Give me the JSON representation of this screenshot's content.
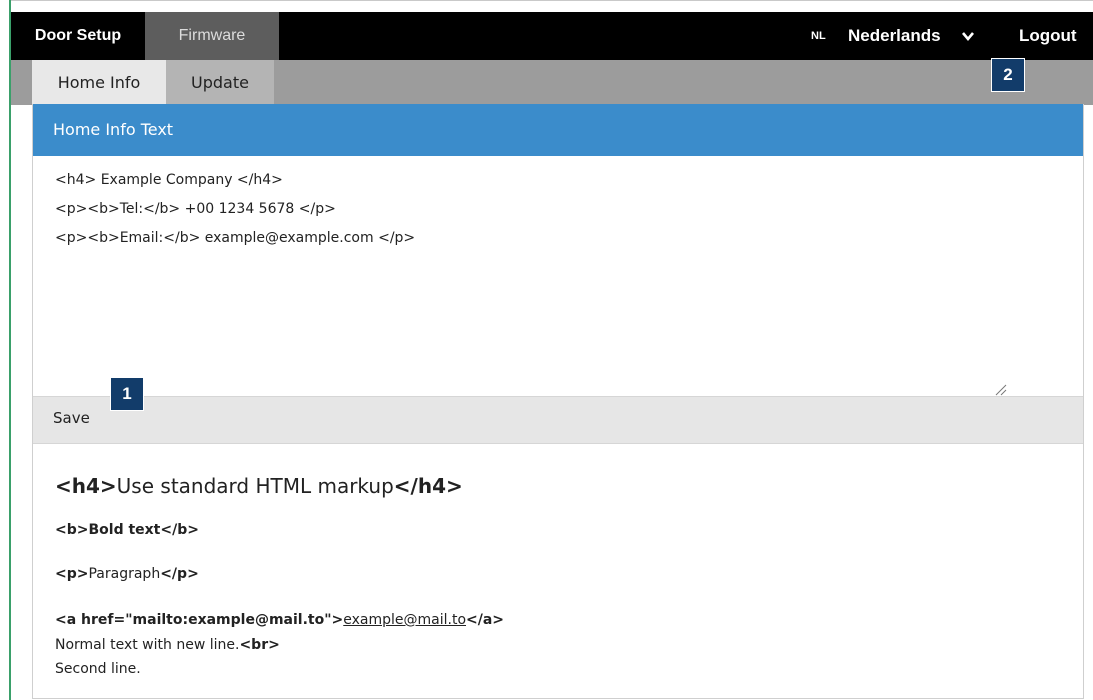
{
  "topnav": {
    "tabs": [
      "Door Setup",
      "Firmware"
    ],
    "language_code": "NL",
    "language_name": "Nederlands",
    "logout_label": "Logout"
  },
  "subnav": {
    "tabs": [
      "Home Info",
      "Update"
    ]
  },
  "panel": {
    "title": "Home Info Text",
    "textarea_lines": [
      "<h4> Example Company </h4>",
      "<p><b>Tel:</b> +00 1234 5678 </p>",
      "<p><b>Email:</b> example@example.com </p>"
    ],
    "save_label": "Save"
  },
  "help": {
    "h4_open": "<h4>",
    "h4_text": "Use standard HTML markup",
    "h4_close": "</h4>",
    "bold_open": "<b>",
    "bold_text": "Bold text",
    "bold_close": "</b>",
    "p_open": "<p>",
    "p_text": "Paragraph",
    "p_close": "</p>",
    "a_open": "<a href=\"mailto:example@mail.to\">",
    "a_text": "example@mail.to",
    "a_close": "</a>",
    "newline_text": "Normal text with new line.",
    "br_tag": "<br>",
    "second_line": "Second line."
  },
  "callouts": [
    "1",
    "2"
  ],
  "colors": {
    "topnav_bg": "#000000",
    "subnav_bg": "#9c9c9c",
    "panel_header_bg": "#3b8ccb",
    "callout_bg": "#123c6a"
  }
}
